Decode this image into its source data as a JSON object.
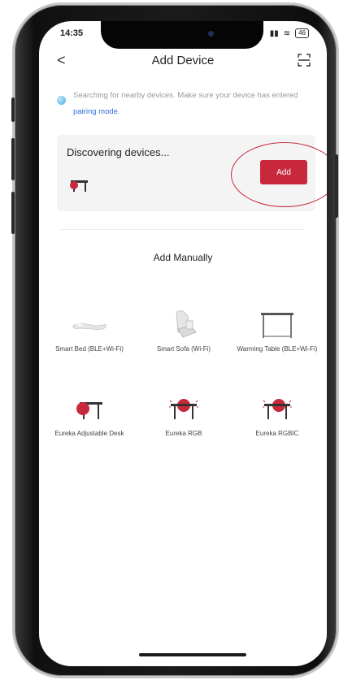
{
  "status_bar": {
    "time": "14:35",
    "battery": "46"
  },
  "nav": {
    "title": "Add Device",
    "back_glyph": "<"
  },
  "search_info": {
    "text": "Searching for nearby devices. Make sure your device has entered ",
    "link": "pairing mode",
    "suffix": "."
  },
  "discovery": {
    "title": "Discovering devices...",
    "add_label": "Add"
  },
  "manual": {
    "title": "Add Manually",
    "devices": [
      {
        "label": "Smart Bed (BLE+Wi-Fi)",
        "icon": "bed-icon"
      },
      {
        "label": "Smart Sofa (Wi-Fi)",
        "icon": "sofa-icon"
      },
      {
        "label": "Warming Table (BLE+Wi-Fi)",
        "icon": "table-icon"
      },
      {
        "label": "Eureka Adjustable Desk",
        "icon": "desk-icon"
      },
      {
        "label": "Eureka RGB",
        "icon": "rgb-desk-icon"
      },
      {
        "label": "Eureka RGBIC",
        "icon": "rgbic-desk-icon"
      }
    ]
  },
  "colors": {
    "accent": "#c8283b",
    "link": "#2f6fd6"
  }
}
